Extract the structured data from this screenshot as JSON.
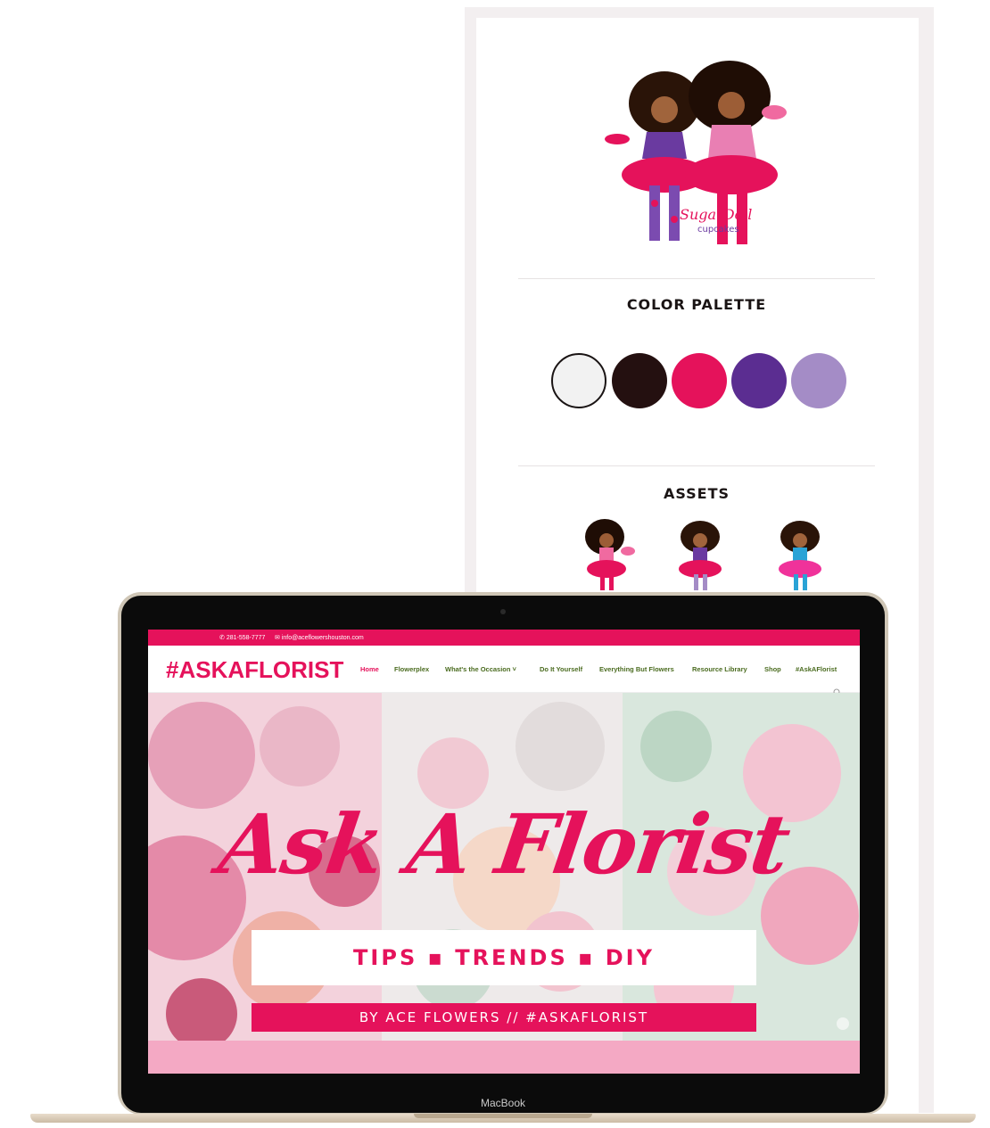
{
  "brand_sheet": {
    "logo": {
      "wordmark_primary": "SugarDoll",
      "wordmark_secondary": "cupcakes",
      "icon": "sugardoll-cupcakes-logo-icon"
    },
    "color_palette_title": "COLOR PALETTE",
    "palette": [
      "#f2f2f2",
      "#241010",
      "#e5125b",
      "#5b2d91",
      "#a48cc6"
    ],
    "assets_title": "ASSETS",
    "assets": [
      "doll-character-1-icon",
      "doll-character-2-icon",
      "doll-character-3-icon"
    ]
  },
  "laptop": {
    "label": "MacBook"
  },
  "website": {
    "topbar": {
      "phone": "281-558-7777",
      "email": "info@aceflowershouston.com"
    },
    "logo": "#ASKAFLORIST",
    "nav": [
      {
        "label": "Home",
        "active": true
      },
      {
        "label": "Flowerplex",
        "active": false
      },
      {
        "label": "What's the Occasion ˅",
        "active": false
      },
      {
        "label": "Do It Yourself",
        "active": false
      },
      {
        "label": "Everything But Flowers",
        "active": false
      },
      {
        "label": "Resource Library",
        "active": false
      },
      {
        "label": "Shop",
        "active": false
      },
      {
        "label": "#AskAFlorist",
        "active": false
      }
    ],
    "hero": {
      "headline": "Ask A Florist",
      "tagline": "TIPS ▪ TRENDS ▪ DIY",
      "byline": "BY ACE FLOWERS // #ASKAFLORIST"
    },
    "colors": {
      "accent": "#e5125b",
      "nav_text": "#4a6b1f",
      "strip": "#f4a9c4"
    }
  }
}
